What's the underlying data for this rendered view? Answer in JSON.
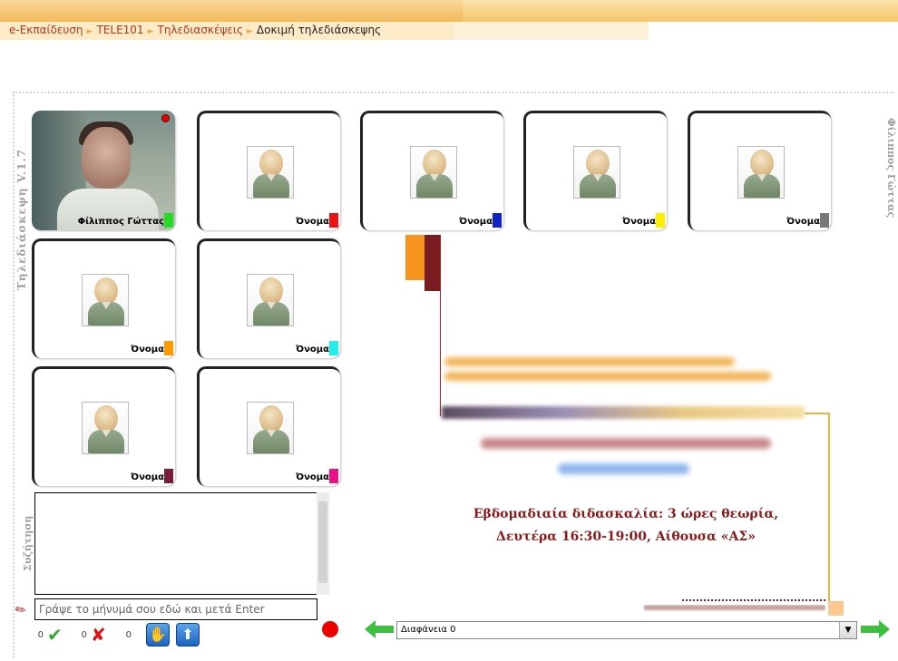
{
  "breadcrumb": {
    "items": [
      "e-Εκπαίδευση",
      "TELE101",
      "Τηλεδιασκέψεις",
      "Δοκιμή τηλεδιάσκεψης"
    ],
    "separator": "►"
  },
  "sidebar": {
    "app_title": "Τηλεδιάσκεψη V.1.7",
    "chat_title": "Συζήτηση",
    "current_user": "Φίλιππος Γώττας"
  },
  "tiles": [
    {
      "name": "Φίλιππος Γώττας",
      "color": "#22dd22",
      "camera": true
    },
    {
      "name": "Όνομα",
      "color": "#ee1111",
      "camera": false
    },
    {
      "name": "Όνομα",
      "color": "#1122cc",
      "camera": false
    },
    {
      "name": "Όνομα",
      "color": "#ffee00",
      "camera": false
    },
    {
      "name": "Όνομα",
      "color": "#777777",
      "camera": false
    },
    {
      "name": "Όνομα",
      "color": "#ff9900",
      "camera": false
    },
    {
      "name": "Όνομα",
      "color": "#22eeee",
      "camera": false
    },
    {
      "name": "Όνομα",
      "color": "#7a1f3a",
      "camera": false
    },
    {
      "name": "Όνομα",
      "color": "#ee1188",
      "camera": false
    }
  ],
  "slide": {
    "line1": "Εβδομαδιαία διδασκαλία: 3 ώρες θεωρία,",
    "line2": "Δευτέρα 16:30-19:00, Αίθουσα «ΑΣ»"
  },
  "chat": {
    "input_placeholder": "Γράψε το μήνυμά σου εδώ και μετά Enter"
  },
  "votes": {
    "hands_count": "0",
    "yes_count": "0",
    "no_count": "0"
  },
  "slides": {
    "selected": "Διαφάνεια 0",
    "dropdown_arrow": "▼"
  },
  "icons": {
    "hand": "✋",
    "upload": "⬆",
    "check": "✔",
    "cross": "✘",
    "pencil": "✎"
  }
}
